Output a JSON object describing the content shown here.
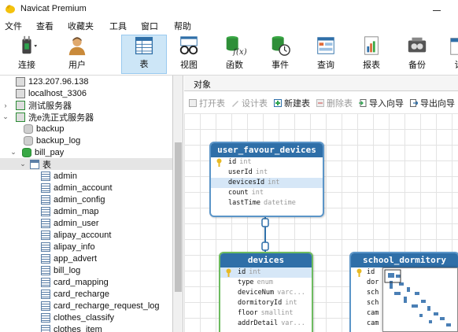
{
  "window": {
    "title": "Navicat Premium"
  },
  "menu": [
    "文件",
    "查看",
    "收藏夹",
    "工具",
    "窗口",
    "帮助"
  ],
  "toolbar": {
    "buttons": [
      {
        "label": "连接",
        "icon": "plug-icon"
      },
      {
        "label": "用户",
        "icon": "user-icon"
      },
      {
        "label": "表",
        "icon": "table-icon",
        "active": true
      },
      {
        "label": "视图",
        "icon": "view-glasses-icon"
      },
      {
        "label": "函数",
        "icon": "function-icon"
      },
      {
        "label": "事件",
        "icon": "event-clock-icon"
      },
      {
        "label": "查询",
        "icon": "query-icon"
      },
      {
        "label": "报表",
        "icon": "report-icon"
      },
      {
        "label": "备份",
        "icon": "backup-icon"
      },
      {
        "label": "计",
        "icon": "schedule-icon"
      }
    ]
  },
  "tree": [
    {
      "label": "123.207.96.138",
      "type": "conn",
      "level": 0
    },
    {
      "label": "localhost_3306",
      "type": "conn",
      "level": 0
    },
    {
      "label": "测试服务器",
      "type": "conn-green",
      "level": 0,
      "arrow": "›"
    },
    {
      "label": "洗e洗正式服务器",
      "type": "conn-green",
      "level": 0,
      "arrow": "⌄"
    },
    {
      "label": "backup",
      "type": "db",
      "level": 1
    },
    {
      "label": "backup_log",
      "type": "db",
      "level": 1
    },
    {
      "label": "bill_pay",
      "type": "db-green",
      "level": 1,
      "arrow": "⌄"
    },
    {
      "label": "表",
      "type": "folder",
      "level": 2,
      "arrow": "⌄",
      "selected": true
    },
    {
      "label": "admin",
      "type": "table",
      "level": 3
    },
    {
      "label": "admin_account",
      "type": "table",
      "level": 3
    },
    {
      "label": "admin_config",
      "type": "table",
      "level": 3
    },
    {
      "label": "admin_map",
      "type": "table",
      "level": 3
    },
    {
      "label": "admin_user",
      "type": "table",
      "level": 3
    },
    {
      "label": "alipay_account",
      "type": "table",
      "level": 3
    },
    {
      "label": "alipay_info",
      "type": "table",
      "level": 3
    },
    {
      "label": "app_advert",
      "type": "table",
      "level": 3
    },
    {
      "label": "bill_log",
      "type": "table",
      "level": 3
    },
    {
      "label": "card_mapping",
      "type": "table",
      "level": 3
    },
    {
      "label": "card_recharge",
      "type": "table",
      "level": 3
    },
    {
      "label": "card_recharge_request_log",
      "type": "table",
      "level": 3
    },
    {
      "label": "clothes_classify",
      "type": "table",
      "level": 3
    },
    {
      "label": "clothes_item",
      "type": "table",
      "level": 3
    }
  ],
  "objects_tab": {
    "label": "对象"
  },
  "object_actions": [
    {
      "label": "打开表",
      "disabled": true
    },
    {
      "label": "设计表",
      "disabled": true
    },
    {
      "label": "新建表",
      "disabled": false
    },
    {
      "label": "删除表",
      "disabled": true
    },
    {
      "label": "导入向导",
      "disabled": false
    },
    {
      "label": "导出向导",
      "disabled": false
    }
  ],
  "er_tables": [
    {
      "name": "user_favour_devices",
      "fields": [
        {
          "name": "id",
          "type": "int",
          "key": true
        },
        {
          "name": "userId",
          "type": "int"
        },
        {
          "name": "devicesId",
          "type": "int",
          "highlight": true
        },
        {
          "name": "count",
          "type": "int"
        },
        {
          "name": "lastTime",
          "type": "datetime"
        }
      ]
    },
    {
      "name": "devices",
      "fields": [
        {
          "name": "id",
          "type": "int",
          "key": true,
          "highlight": true
        },
        {
          "name": "type",
          "type": "enum"
        },
        {
          "name": "deviceNum",
          "type": "varc..."
        },
        {
          "name": "dormitoryId",
          "type": "int"
        },
        {
          "name": "floor",
          "type": "smallint"
        },
        {
          "name": "addrDetail",
          "type": "var..."
        }
      ]
    },
    {
      "name": "school_dormitory",
      "fields": [
        {
          "name": "id",
          "type": "",
          "key": true
        },
        {
          "name": "dor",
          "type": ""
        },
        {
          "name": "sch",
          "type": ""
        },
        {
          "name": "sch",
          "type": ""
        },
        {
          "name": "cam",
          "type": ""
        },
        {
          "name": "cam",
          "type": ""
        }
      ]
    }
  ]
}
